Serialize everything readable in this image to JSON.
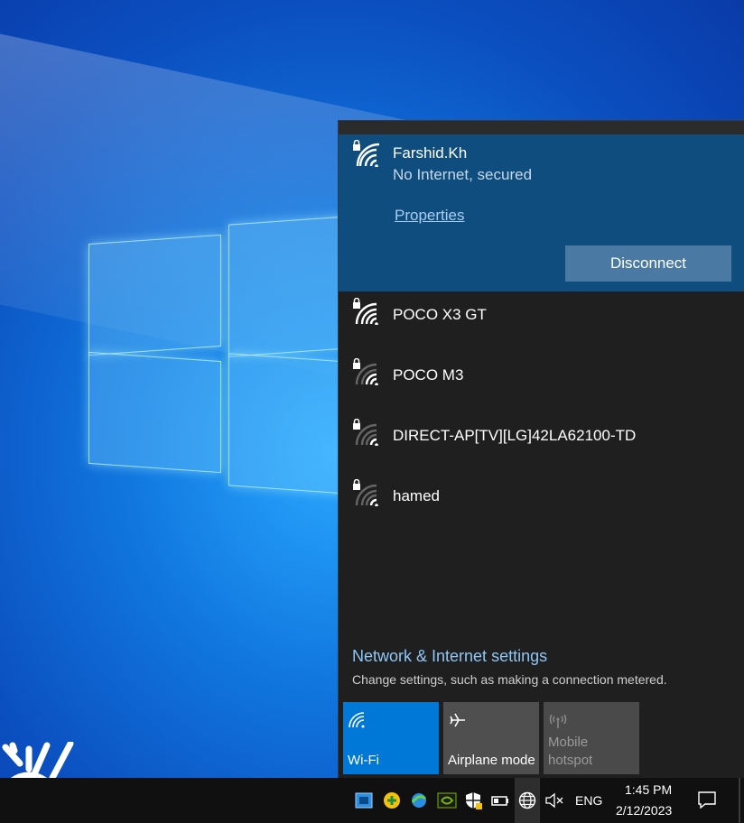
{
  "flyout": {
    "connected_network": {
      "name": "Farshid.Kh",
      "status": "No Internet, secured",
      "properties_label": "Properties",
      "disconnect_label": "Disconnect"
    },
    "networks": [
      {
        "name": "POCO X3 GT",
        "signal": "strong"
      },
      {
        "name": "POCO M3",
        "signal": "weak"
      },
      {
        "name": "DIRECT-AP[TV][LG]42LA62100-TD",
        "signal": "weak"
      },
      {
        "name": "hamed",
        "signal": "weak"
      }
    ],
    "settings_link": "Network & Internet settings",
    "settings_description": "Change settings, such as making a connection metered.",
    "quick_actions": [
      {
        "label": "Wi-Fi",
        "icon": "wifi-icon",
        "state": "on"
      },
      {
        "label": "Airplane mode",
        "icon": "airplane-icon",
        "state": "off"
      },
      {
        "label": "Mobile hotspot",
        "icon": "hotspot-icon",
        "state": "disabled"
      }
    ]
  },
  "taskbar": {
    "language": "ENG",
    "time": "1:45 PM",
    "date": "2/12/2023",
    "tray_icons": [
      "network-adapter-icon",
      "download-manager-icon",
      "internet-download-icon",
      "nvidia-icon",
      "security-shield-icon",
      "battery-icon",
      "globe-network-icon",
      "speaker-muted-icon"
    ]
  },
  "colors": {
    "accent": "#0078d7",
    "connected_bg": "#0f4d7e",
    "flyout_bg": "#1f1f1f",
    "link": "#8ec6f5"
  }
}
